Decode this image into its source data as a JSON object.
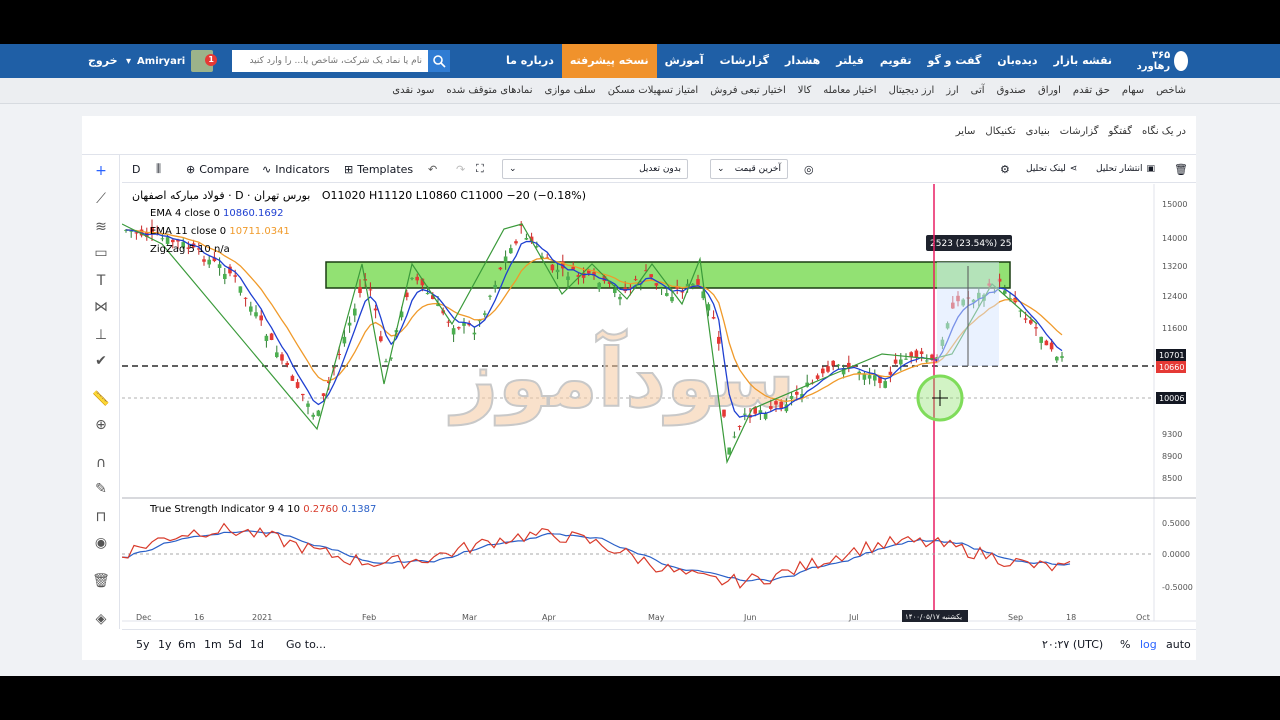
{
  "nav": {
    "logo_text": "۳۶۵ رهاورد",
    "items": [
      "نقشه بازار",
      "دیده‌بان",
      "گفت و گو",
      "تقویم",
      "فیلتر",
      "هشدار",
      "گزارشات",
      "آموزش",
      "نسخه پیشرفته",
      "درباره ما"
    ],
    "active": "نسخه پیشرفته",
    "search_placeholder": "نام یا نماد یک شرکت، شاخص یا... را وارد کنید",
    "username": "Amiryari",
    "notif_count": "1",
    "logout": "خروج"
  },
  "subnav": [
    "شاخص",
    "سهام",
    "حق تقدم",
    "اوراق",
    "صندوق",
    "آتی",
    "ارز",
    "ارز دیجیتال",
    "اختیار معامله",
    "کالا",
    "اختیار تبعی فروش",
    "امتیاز تسهیلات مسکن",
    "سلف موازی",
    "نمادهای متوقف شده",
    "سود نقدی"
  ],
  "breadcrumbs": [
    "در یک نگاه",
    "گفتگو",
    "گزارشات",
    "بنیادی",
    "تکنیکال",
    "سایر"
  ],
  "toolbar": {
    "interval": "D",
    "compare": "Compare",
    "indicators": "Indicators",
    "templates": "Templates",
    "adjust": "بدون تعدیل",
    "price": "آخرین قیمت",
    "link": "لینک تحلیل",
    "publish": "انتشار تحلیل"
  },
  "symbol": {
    "title": "فولاد مبارکه اصفهان · D · بورس تهران",
    "ohlc": "O11020 H11120 L10860 C11000 −20 (−0.18%)"
  },
  "indicators": {
    "ema4": "EMA 4 close 0",
    "ema4_val": "10860.1692",
    "ema11": "EMA 11 close 0",
    "ema11_val": "10711.0341",
    "zigzag": "ZigZag 5 10",
    "zigzag_val": "n/a",
    "tsi": "True Strength Indicator 9 4 10",
    "tsi_val1": "0.2760",
    "tsi_val2": "0.1387"
  },
  "measure_label": "2523 (23.54%) 2523",
  "price_axis": [
    "15000",
    "14000",
    "13200",
    "12400",
    "11600",
    "10701",
    "10660",
    "10006",
    "9300",
    "8900",
    "8500"
  ],
  "tsi_axis": [
    "0.5000",
    "0.0000",
    "-0.5000"
  ],
  "time_axis": [
    "Dec",
    "16",
    "2021",
    "Feb",
    "Mar",
    "Apr",
    "May",
    "Jun",
    "Jul",
    "Sep",
    "18",
    "Oct"
  ],
  "crosshair_date": "یکشنبه ۱۴۰۰/۰۵/۱۷",
  "watermark": "سودآموز",
  "bottom": {
    "ranges": [
      "5y",
      "1y",
      "6m",
      "1m",
      "5d",
      "1d"
    ],
    "goto": "Go to...",
    "time": "۲۰:۲۷ (UTC)",
    "pct": "%",
    "log": "log",
    "auto": "auto"
  },
  "colors": {
    "nav": "#1f5fa6",
    "active": "#f0922c",
    "ema4": "#1e3fd1",
    "ema11": "#f09a2a",
    "zigzag": "#3a9a3a",
    "zone": "#7fdc5a"
  }
}
